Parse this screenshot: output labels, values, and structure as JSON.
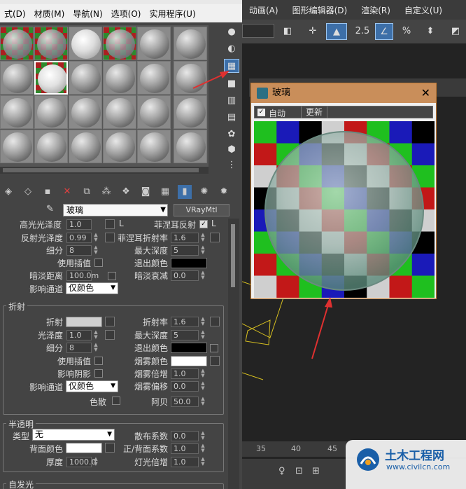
{
  "menubar": {
    "items": [
      "式(D)",
      "材质(M)",
      "导航(N)",
      "选项(O)",
      "实用程序(U)"
    ]
  },
  "main_menu": {
    "items": [
      "动画(A)",
      "图形编辑器(D)",
      "渲染(R)",
      "自定义(U)"
    ]
  },
  "toolbar2": {
    "snap_value": "2.5",
    "percent": "%"
  },
  "material": {
    "name": "玻璃",
    "type": "VRayMtl"
  },
  "reflection": {
    "gloss_label": "高光光泽度",
    "gloss_value": "1.0",
    "l_label": "L",
    "fresnel_label": "菲涅耳反射",
    "l2_label": "L",
    "refl_gloss_label": "反射光泽度",
    "refl_gloss_value": "0.99",
    "fresnel_ior_label": "菲涅耳折射率",
    "fresnel_ior_value": "1.6",
    "subdivs_label": "细分",
    "subdivs_value": "8",
    "max_depth_label": "最大深度",
    "max_depth_value": "5",
    "use_interp_label": "使用插值",
    "exit_color_label": "退出颜色",
    "dim_dist_label": "暗淡距离",
    "dim_dist_value": "100.0m",
    "dim_falloff_label": "暗淡衰减",
    "dim_falloff_value": "0.0",
    "affect_ch_label": "影响通道",
    "affect_ch_value": "仅颜色"
  },
  "refraction": {
    "title": "折射",
    "refract_label": "折射",
    "ior_label": "折射率",
    "ior_value": "1.6",
    "gloss_label": "光泽度",
    "gloss_value": "1.0",
    "max_depth_label": "最大深度",
    "max_depth_value": "5",
    "subdivs_label": "细分",
    "subdivs_value": "8",
    "exit_color_label": "退出颜色",
    "use_interp_label": "使用插值",
    "fog_color_label": "烟雾颜色",
    "affect_shadows_label": "影响阴影",
    "fog_mult_label": "烟雾倍增",
    "fog_mult_value": "1.0",
    "affect_ch_label": "影响通道",
    "affect_ch_value": "仅颜色",
    "fog_bias_label": "烟雾偏移",
    "fog_bias_value": "0.0",
    "dispersion_label": "色散",
    "abbe_label": "阿贝",
    "abbe_value": "50.0"
  },
  "translucency": {
    "title": "半透明",
    "type_label": "类型",
    "type_value": "无",
    "scatter_label": "散布系数",
    "scatter_value": "0.0",
    "back_color_label": "背面颜色",
    "fb_label": "正/背面系数",
    "fb_value": "1.0",
    "thickness_label": "厚度",
    "thickness_value": "1000.0",
    "light_mult_label": "灯光倍增",
    "light_mult_value": "1.0"
  },
  "self_illum": {
    "title": "自发光"
  },
  "preview": {
    "title": "玻璃",
    "auto_label": "自动",
    "update_label": "更新",
    "close": "✕"
  },
  "timeline": {
    "ticks": [
      "35",
      "40",
      "45"
    ]
  },
  "watermark": {
    "title": "土木工程网",
    "url": "www.civilcn.com"
  },
  "colors": {
    "accent": "#3d6fa8",
    "preview_title_bg": "#c98e5a",
    "arrow": "#e03030",
    "checker": [
      "#1fbf1f",
      "#c21818",
      "#1a1ab8",
      "#000000",
      "#cfcfcf"
    ]
  }
}
